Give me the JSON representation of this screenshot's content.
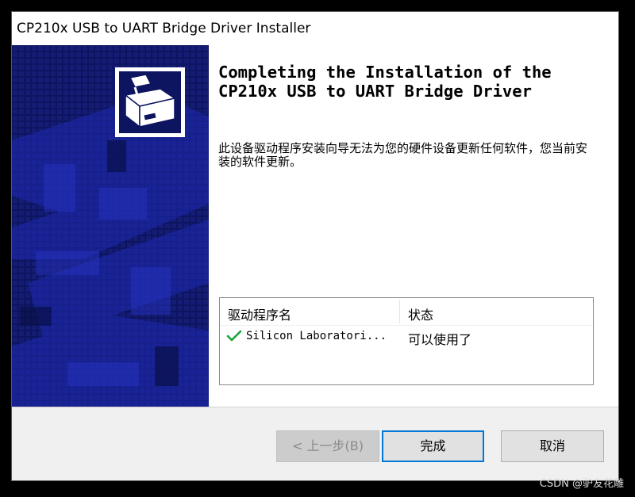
{
  "window": {
    "title": "CP210x USB to UART Bridge Driver Installer"
  },
  "banner": {
    "logo_icon": "installer-box-icon",
    "background_color": "#0d1460"
  },
  "content": {
    "heading_line1": "Completing the Installation of the",
    "heading_line2": "CP210x USB to UART Bridge Driver",
    "message": "此设备驱动程序安装向导无法为您的硬件设备更新任何软件，您当前安装的软件更新。"
  },
  "driver_table": {
    "columns": [
      "驱动程序名",
      "状态"
    ],
    "rows": [
      {
        "status_icon": "check-icon",
        "name": "Silicon Laboratori...",
        "status": "可以使用了"
      }
    ]
  },
  "buttons": {
    "back": "< 上一步(B)",
    "finish": "完成",
    "cancel": "取消"
  },
  "watermark": "CSDN @驴友花雕",
  "colors": {
    "accent": "#0078d7",
    "check": "#1aa33a"
  }
}
